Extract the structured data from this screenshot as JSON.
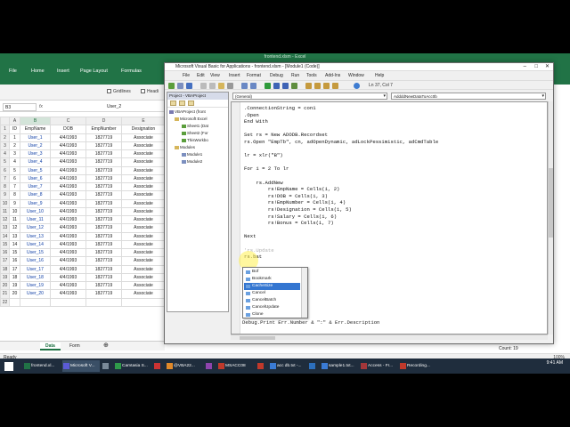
{
  "excel": {
    "title": "frontend.xlsm - Excel",
    "tabs": [
      "File",
      "Home",
      "Insert",
      "Page Layout",
      "Formulas"
    ],
    "options": {
      "gridlines": "Gridlines",
      "headings": "Headi"
    },
    "name_box": "B3",
    "fx": "fx",
    "formula_value": "User_2",
    "columns": [
      "A",
      "B",
      "C",
      "D",
      "E"
    ],
    "headers": [
      "ID",
      "EmpName",
      "DOB",
      "EmpNumber",
      "Designation"
    ],
    "rows": [
      [
        "1",
        "User_1",
        "4/4/1993",
        "1827719",
        "Associate"
      ],
      [
        "2",
        "User_2",
        "4/4/1993",
        "1827719",
        "Associate"
      ],
      [
        "3",
        "User_3",
        "4/4/1993",
        "1827719",
        "Associate"
      ],
      [
        "4",
        "User_4",
        "4/4/1993",
        "1827719",
        "Associate"
      ],
      [
        "5",
        "User_5",
        "4/4/1993",
        "1827719",
        "Associate"
      ],
      [
        "6",
        "User_6",
        "4/4/1993",
        "1827719",
        "Associate"
      ],
      [
        "7",
        "User_7",
        "4/4/1993",
        "1827719",
        "Associate"
      ],
      [
        "8",
        "User_8",
        "4/4/1993",
        "1827719",
        "Associate"
      ],
      [
        "9",
        "User_9",
        "4/4/1993",
        "1827719",
        "Associate"
      ],
      [
        "10",
        "User_10",
        "4/4/1993",
        "1827719",
        "Associate"
      ],
      [
        "11",
        "User_11",
        "4/4/1993",
        "1827719",
        "Associate"
      ],
      [
        "12",
        "User_12",
        "4/4/1993",
        "1827719",
        "Associate"
      ],
      [
        "13",
        "User_13",
        "4/4/1993",
        "1827719",
        "Associate"
      ],
      [
        "14",
        "User_14",
        "4/4/1993",
        "1827719",
        "Associate"
      ],
      [
        "15",
        "User_15",
        "4/4/1993",
        "1827719",
        "Associate"
      ],
      [
        "16",
        "User_16",
        "4/4/1993",
        "1827719",
        "Associate"
      ],
      [
        "17",
        "User_17",
        "4/4/1993",
        "1827719",
        "Associate"
      ],
      [
        "18",
        "User_18",
        "4/4/1993",
        "1827719",
        "Associate"
      ],
      [
        "19",
        "User_19",
        "4/4/1993",
        "1827719",
        "Associate"
      ],
      [
        "20",
        "User_20",
        "4/4/1993",
        "1827719",
        "Associate"
      ]
    ],
    "sheets": [
      "Data",
      "Form"
    ],
    "status_left": "Ready",
    "status_right": "100%"
  },
  "vbe": {
    "title": "Microsoft Visual Basic for Applications - frontend.xlsm - [Module1 (Code)]",
    "menu": [
      "File",
      "Edit",
      "View",
      "Insert",
      "Format",
      "Debug",
      "Run",
      "Tools",
      "Add-Ins",
      "Window",
      "Help"
    ],
    "cursor_pos": "Ln 37, Col 7",
    "project_title": "Project - VBAProject",
    "tree": [
      "VBAProject (front",
      "Microsoft Excel",
      "Sheet1 (Dat",
      "Sheet2 (For",
      "ThisWorkbo",
      "Modules",
      "Module1",
      "Module2"
    ],
    "combo_left": "(General)",
    "combo_right": "AddddNewDataToAcc0b",
    "code": [
      ".ConnectionString = con1",
      ".Open",
      "End With",
      "",
      "Set rs = New ADODB.Recordset",
      "rs.Open \"EmpTb\", cn, adOpenDynamic, adLockPessimistic, adCmdTable",
      "",
      "lr = xlr(\"B\")",
      "",
      "For i = 2 To lr",
      "",
      "    rs.AddNew",
      "        rs!EmpName = Cells(i, 2)",
      "        rs!DOB = Cells(i, 3)",
      "        rs!EmpNumber = Cells(i, 4)",
      "        rs!Designation = Cells(i, 5)",
      "        rs!Salary = Cells(i, 6)",
      "        rs!Bonus = Cells(i, 7)",
      "",
      "Next",
      "",
      "'rs.Update",
      "rs.bat"
    ],
    "intellisense": [
      "Bof",
      "Bookmark",
      "CacheSize",
      "Cancel",
      "CancelBatch",
      "CancelUpdate",
      "Clone"
    ],
    "intellisense_selected": "CacheSize",
    "after_line": "Debug.Print Err.Number & \":\" & Err.Description",
    "status_count": "Count: 19"
  },
  "taskbar": {
    "items": [
      "frontend.xl...",
      "Microsoft V...",
      "",
      "Camtasia S...",
      "",
      "@VBA22...",
      "",
      "MSACC08",
      "",
      "acc db.txt -...",
      "",
      "sample1.txt...",
      "Access - Fr...",
      "Recording..."
    ],
    "time": "9:41 AM",
    "date": ""
  }
}
